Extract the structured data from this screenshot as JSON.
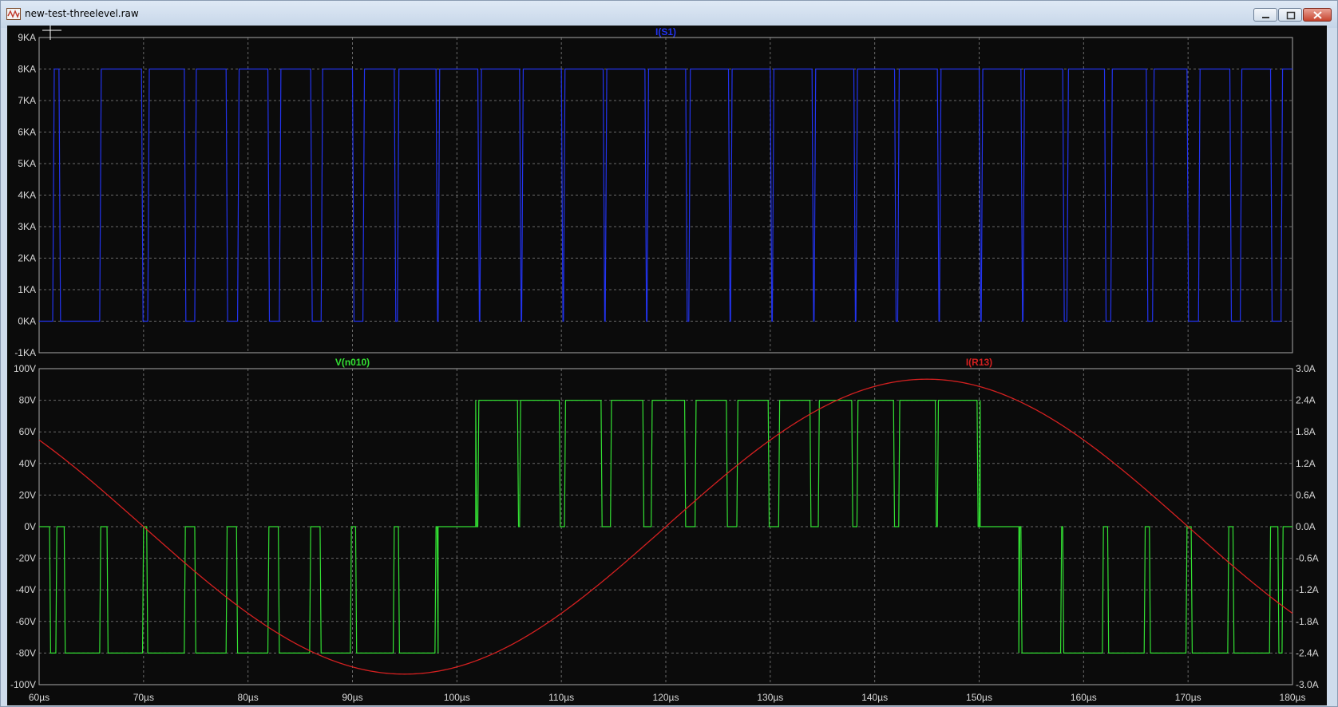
{
  "window": {
    "title": "new-test-threelevel.raw"
  },
  "chart_data": [
    {
      "type": "line",
      "title": "I(S1)",
      "x_unit": "µs",
      "xlim": [
        60,
        180
      ],
      "ylim": [
        -1000,
        9000
      ],
      "yticks": [
        9000,
        8000,
        7000,
        6000,
        5000,
        4000,
        3000,
        2000,
        1000,
        0,
        -1000
      ],
      "ytick_labels": [
        "9KA",
        "8KA",
        "7KA",
        "6KA",
        "5KA",
        "4KA",
        "3KA",
        "2KA",
        "1KA",
        "0KA",
        "-1KA"
      ],
      "grid": true,
      "series": [
        {
          "name": "I(S1)",
          "color": "#2233ee",
          "low": 0,
          "high": 8000,
          "off_intervals_us": [
            [
              60.0,
              61.3
            ],
            [
              61.9,
              65.8
            ],
            [
              69.8,
              70.4
            ],
            [
              73.9,
              74.9
            ],
            [
              77.9,
              79.0
            ],
            [
              81.9,
              83.0
            ],
            [
              86.0,
              87.0
            ],
            [
              90.0,
              91.0
            ],
            [
              94.0,
              94.3
            ],
            [
              98.0,
              98.2
            ],
            [
              102.0,
              102.2
            ],
            [
              106.0,
              106.2
            ],
            [
              110.0,
              110.2
            ],
            [
              114.0,
              114.2
            ],
            [
              118.0,
              118.2
            ],
            [
              121.9,
              122.2
            ],
            [
              126.0,
              126.2
            ],
            [
              130.0,
              130.2
            ],
            [
              134.0,
              134.2
            ],
            [
              138.0,
              138.2
            ],
            [
              141.9,
              142.2
            ],
            [
              146.0,
              146.2
            ],
            [
              150.0,
              150.2
            ],
            [
              154.0,
              154.2
            ],
            [
              158.0,
              158.4
            ],
            [
              162.0,
              162.6
            ],
            [
              166.0,
              166.6
            ],
            [
              169.9,
              171.0
            ],
            [
              174.0,
              175.0
            ],
            [
              177.9,
              178.9
            ]
          ]
        }
      ]
    },
    {
      "type": "line",
      "x_unit": "µs",
      "xlim": [
        60,
        180
      ],
      "xticks": [
        60,
        70,
        80,
        90,
        100,
        110,
        120,
        130,
        140,
        150,
        160,
        170,
        180
      ],
      "xtick_labels": [
        "60µs",
        "70µs",
        "80µs",
        "90µs",
        "100µs",
        "110µs",
        "120µs",
        "130µs",
        "140µs",
        "150µs",
        "160µs",
        "170µs",
        "180µs"
      ],
      "ylim_left": [
        -100,
        100
      ],
      "yticks_left": [
        100,
        80,
        60,
        40,
        20,
        0,
        -20,
        -40,
        -60,
        -80,
        -100
      ],
      "ytick_labels_left": [
        "100V",
        "80V",
        "60V",
        "40V",
        "20V",
        "0V",
        "-20V",
        "-40V",
        "-60V",
        "-80V",
        "-100V"
      ],
      "ylim_right": [
        -3.0,
        3.0
      ],
      "yticks_right": [
        3.0,
        2.4,
        1.8,
        1.2,
        0.6,
        0.0,
        -0.6,
        -1.2,
        -1.8,
        -2.4,
        -3.0
      ],
      "ytick_labels_right": [
        "3.0A",
        "2.4A",
        "1.8A",
        "1.2A",
        "0.6A",
        "0.0A",
        "-0.6A",
        "-1.2A",
        "-1.8A",
        "-2.4A",
        "-3.0A"
      ],
      "grid": true,
      "series": [
        {
          "name": "V(n010)",
          "color": "#33e033",
          "axis": "left",
          "negative_pulses_us": [
            [
              61.6,
              62.4
            ],
            [
              65.8,
              66.5
            ],
            [
              69.9,
              70.3
            ],
            [
              73.9,
              74.9
            ],
            [
              77.9,
              78.9
            ],
            [
              81.9,
              82.9
            ],
            [
              85.9,
              86.9
            ],
            [
              89.8,
              90.3
            ],
            [
              93.9,
              94.4
            ],
            [
              97.9,
              98.1
            ]
          ],
          "positive_pulses_us": [
            [
              101.8,
              102.0
            ],
            [
              105.8,
              106.0
            ],
            [
              109.8,
              110.3
            ],
            [
              113.8,
              114.7
            ],
            [
              117.8,
              118.6
            ],
            [
              121.8,
              122.8
            ],
            [
              125.8,
              126.8
            ],
            [
              129.8,
              130.8
            ],
            [
              133.8,
              134.6
            ],
            [
              137.8,
              138.3
            ],
            [
              141.8,
              142.3
            ],
            [
              145.8,
              146.0
            ],
            [
              149.8,
              150.0
            ]
          ],
          "negative_pulses_us_2": [
            [
              153.8,
              154.0
            ],
            [
              157.8,
              158.0
            ],
            [
              161.8,
              162.3
            ],
            [
              165.8,
              166.3
            ],
            [
              169.8,
              170.3
            ],
            [
              173.8,
              174.3
            ],
            [
              177.8,
              178.6
            ]
          ],
          "low": -80,
          "zero": 0,
          "high": 80
        },
        {
          "name": "I(R13)",
          "color": "#d42020",
          "axis": "right",
          "amplitude_A": 2.8,
          "period_us": 100,
          "peak_at_us": 145,
          "min_at_us": 95
        }
      ]
    }
  ]
}
